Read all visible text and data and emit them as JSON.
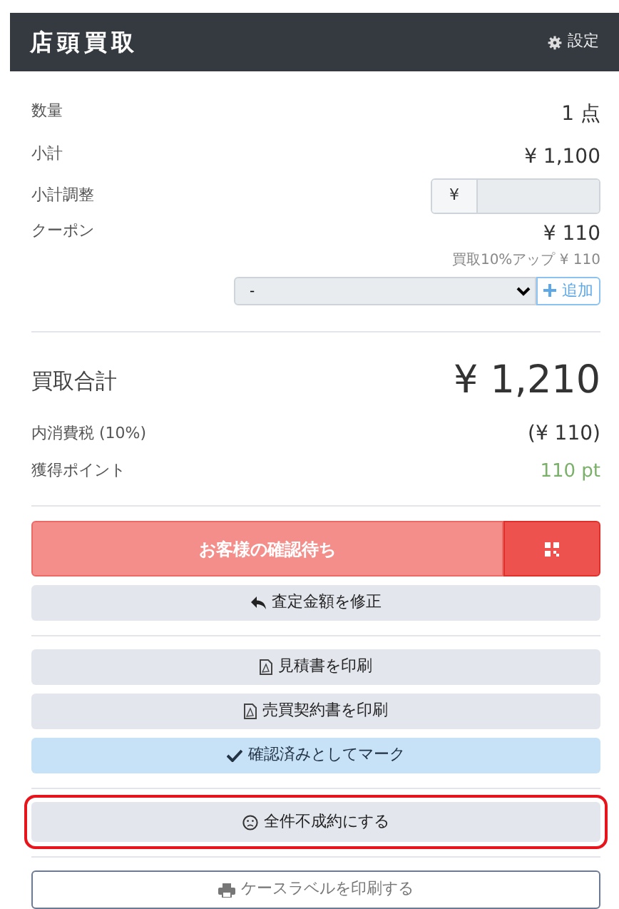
{
  "header": {
    "title": "店頭買取",
    "settings_label": "設定"
  },
  "summary": [
    {
      "label": "数量",
      "value": "1 点"
    },
    {
      "label": "小計",
      "value": "¥ 1,100"
    }
  ],
  "adjustment": {
    "label": "小計調整",
    "prefix": "¥"
  },
  "coupon": {
    "label": "クーポン",
    "value": "¥ 110",
    "detail": "買取10%アップ ¥ 110",
    "select_value": "-",
    "add_label": "追加"
  },
  "total": {
    "label": "買取合計",
    "value": "¥ 1,210"
  },
  "totals": [
    {
      "label": "内消費税 (10%)",
      "value": "(¥ 110)",
      "kind": "plain"
    },
    {
      "label": "獲得ポイント",
      "value": "110 pt",
      "kind": "points"
    }
  ],
  "action_groups": [
    [
      {
        "label": "お客様の確認待ち",
        "kind": "pending",
        "highlighted": false
      },
      {
        "label": "査定金額を修正",
        "kind": "revise",
        "highlighted": false
      }
    ],
    [
      {
        "label": "見積書を印刷",
        "kind": "pdf",
        "highlighted": false
      },
      {
        "label": "売買契約書を印刷",
        "kind": "pdf",
        "highlighted": false
      },
      {
        "label": "確認済みとしてマーク",
        "kind": "confirm",
        "highlighted": false
      }
    ],
    [
      {
        "label": "全件不成約にする",
        "kind": "cancel",
        "highlighted": true
      }
    ],
    [
      {
        "label": "ケースラベルを印刷する",
        "kind": "label",
        "highlighted": false
      }
    ]
  ]
}
